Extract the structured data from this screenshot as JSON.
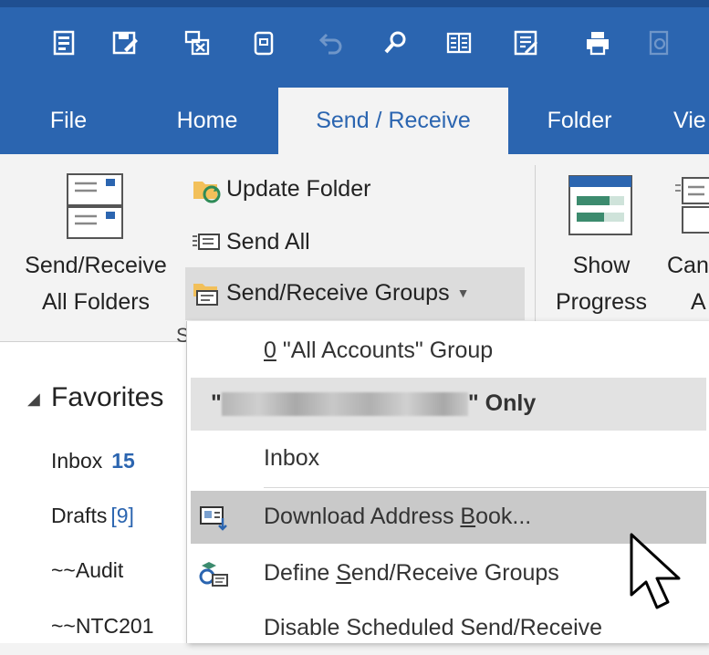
{
  "qat": {
    "icons": [
      "new-items-icon",
      "save-as-icon",
      "delete-icon",
      "archive-icon",
      "undo-icon",
      "search-icon",
      "address-book-icon",
      "forms-icon",
      "print-icon",
      "print-preview-icon"
    ]
  },
  "tabs": {
    "file": "File",
    "home": "Home",
    "send_receive": "Send / Receive",
    "folder": "Folder",
    "view": "Vie"
  },
  "ribbon": {
    "send_receive_all_line1": "Send/Receive",
    "send_receive_all_line2": "All Folders",
    "update_folder": "Update Folder",
    "send_all": "Send All",
    "send_receive_groups": "Send/Receive Groups",
    "group_label": "S",
    "show_progress_line1": "Show",
    "show_progress_line2": "Progress",
    "cancel_line1": "Can",
    "cancel_line2": "A"
  },
  "nav": {
    "favorites": "Favorites",
    "inbox": "Inbox",
    "inbox_count": "15",
    "drafts": "Drafts",
    "drafts_count": "[9]",
    "audit": "~~Audit",
    "ntc": "~~NTC201"
  },
  "menu": {
    "all_accounts_key": "0",
    "all_accounts": " \"All Accounts\" Group",
    "account_prefix": "\"",
    "account_suffix": "\" Only",
    "inbox": "Inbox",
    "download_pre": "Download Address ",
    "download_key": "B",
    "download_post": "ook...",
    "define_pre": "Define ",
    "define_key": "S",
    "define_post": "end/Receive Groups",
    "disable": "Disable Scheduled Send/Receive"
  },
  "colors": {
    "accent": "#2b65b0",
    "ribbon_bg": "#f3f3f3",
    "menu_hover": "#c9c9c9"
  }
}
